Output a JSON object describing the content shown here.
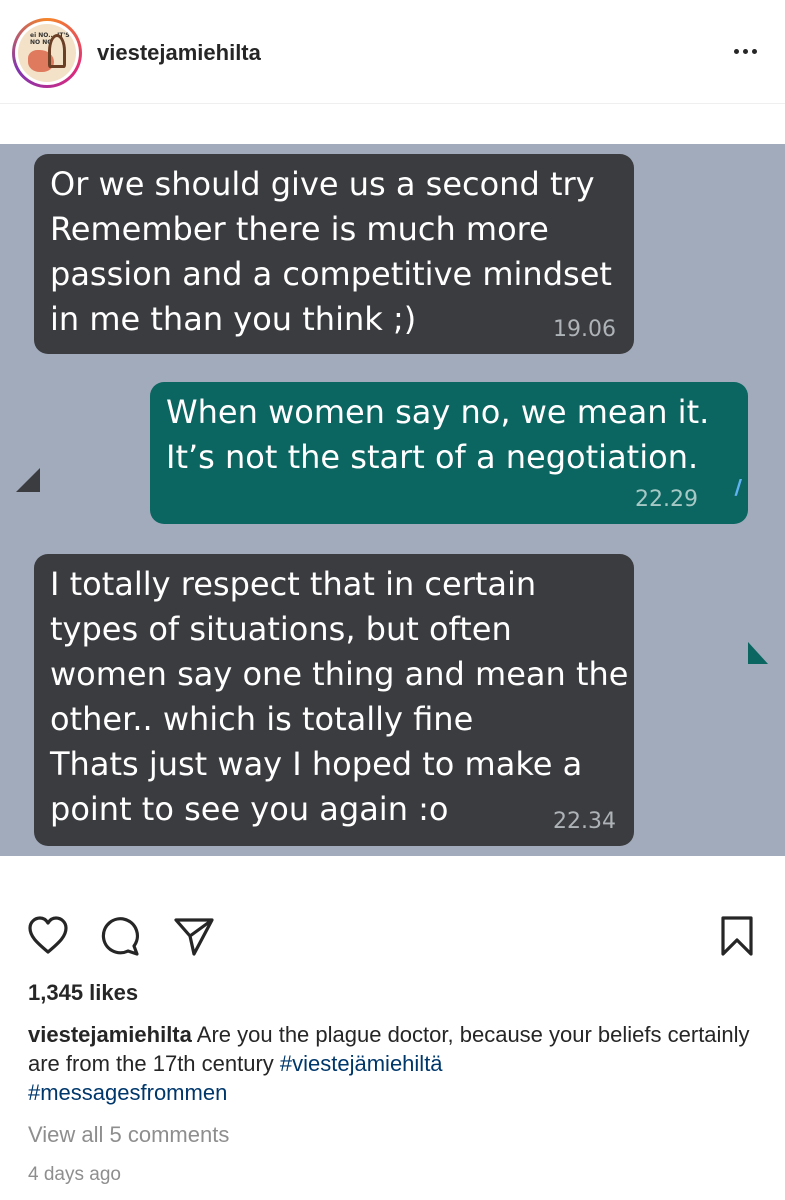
{
  "post": {
    "username": "viestejamiehilta",
    "avatar_icon": "profile-avatar-icon",
    "avatar_text": "ei NO... IT'S NO NO"
  },
  "screenshot": {
    "background": "#a2abbc",
    "messages": [
      {
        "direction": "incoming",
        "lines": [
          "Or we should give us a second try",
          "Remember there is much more",
          "passion and a competitive mindset",
          "in me than you think ;)"
        ],
        "time": "19.06"
      },
      {
        "direction": "outgoing",
        "lines": [
          "When women say no, we mean it.",
          "It’s not the start of a negotiation."
        ],
        "time": "22.29",
        "status_icon": "double-check-icon"
      },
      {
        "direction": "incoming",
        "lines": [
          "I totally respect that in certain",
          "types of situations, but often",
          "women say one thing and mean the",
          "other.. which is totally fine",
          "Thats just way I hoped to make a",
          "point to see you again :o"
        ],
        "time": "22.34"
      }
    ]
  },
  "actions": {
    "like_icon": "heart-icon",
    "comment_icon": "comment-icon",
    "share_icon": "paper-plane-icon",
    "save_icon": "bookmark-icon",
    "more_icon": "more-options-icon"
  },
  "likes": "1,345 likes",
  "caption": {
    "username": "viestejamiehilta",
    "text": " Are you the plague doctor, because your beliefs certainly are from the 17th century ",
    "hashtag1": "#viestejämiehiltä",
    "hashtag2": "#messagesfrommen"
  },
  "view_comments": "View all 5 comments",
  "time_ago": "4 days ago"
}
